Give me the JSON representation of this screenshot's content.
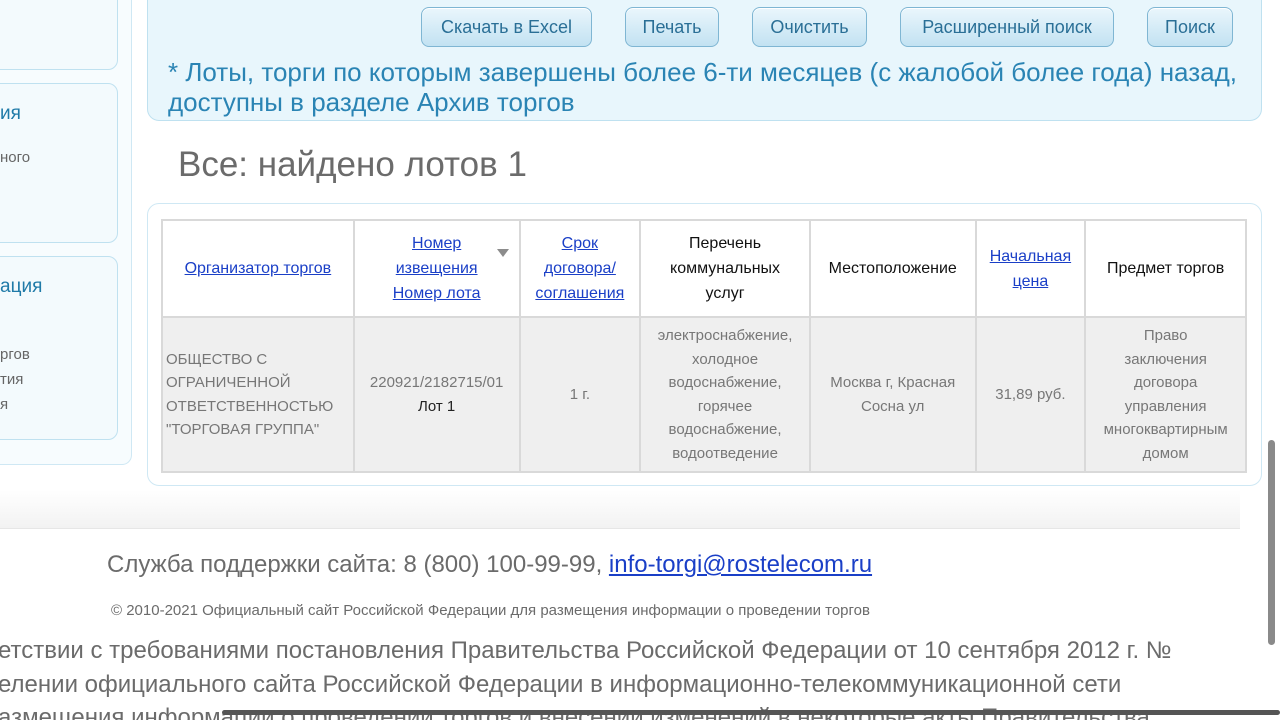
{
  "sidebar": {
    "box2_title": "ия",
    "box2_sub": "ного",
    "box3_title": "ация",
    "box3_sub1": "ргов",
    "box3_sub2": "тия",
    "box3_sub3": "я"
  },
  "toolbar": {
    "excel": "Скачать в Excel",
    "print": "Печать",
    "clear": "Очистить",
    "advanced": "Расширенный поиск",
    "search": "Поиск"
  },
  "archive_note": "* Лоты, торги по которым завершены более 6-ти месяцев (с жалобой более года) назад, доступны в разделе Архив торгов",
  "found_title": "Все: найдено лотов 1",
  "table": {
    "headers": {
      "organizer": "Организатор торгов",
      "notice_line1": "Номер",
      "notice_line2": "извещения",
      "notice_line3": "Номер лота",
      "term_line1": "Срок",
      "term_line2": "договора/",
      "term_line3": "соглашения",
      "services_line1": "Перечень",
      "services_line2": "коммунальных",
      "services_line3": "услуг",
      "location": "Местоположение",
      "price_line1": "Начальная",
      "price_line2": "цена",
      "subject": "Предмет торгов"
    },
    "rows": [
      {
        "org_line1": "ОБЩЕСТВО С",
        "org_line2": "ОГРАНИЧЕННОЙ",
        "org_line3": "ОТВЕТСТВЕННОСТЬЮ",
        "org_line4": "\"ТОРГОВАЯ ГРУППА\"",
        "notice": "220921/2182715/01",
        "lot": "Лот 1",
        "term": "1 г.",
        "services_line1": "электроснабжение,",
        "services_line2": "холодное",
        "services_line3": "водоснабжение,",
        "services_line4": "горячее",
        "services_line5": "водоснабжение,",
        "services_line6": "водоотведение",
        "location_line1": "Москва г, Красная",
        "location_line2": "Сосна ул",
        "price": "31,89 руб.",
        "subject_line1": "Право",
        "subject_line2": "заключения",
        "subject_line3": "договора",
        "subject_line4": "управления",
        "subject_line5": "многоквартирным",
        "subject_line6": "домом"
      }
    ]
  },
  "footer": {
    "support_prefix": "Служба поддержки сайта: 8 (800) 100-99-99, ",
    "support_email": "info-torgi@rostelecom.ru",
    "copyright": "© 2010-2021 Официальный сайт Российской Федерации для размещения информации о проведении торгов",
    "legal_line1": "етствии с требованиями постановления Правительства Российской Федерации от 10 сентября 2012 г. №",
    "legal_line2": "елении официального сайта Российской Федерации в информационно-телекоммуникационной сети",
    "legal_line3": "азмещения информации о проведении торгов и внесении изменений в некоторые акты Правительства"
  }
}
